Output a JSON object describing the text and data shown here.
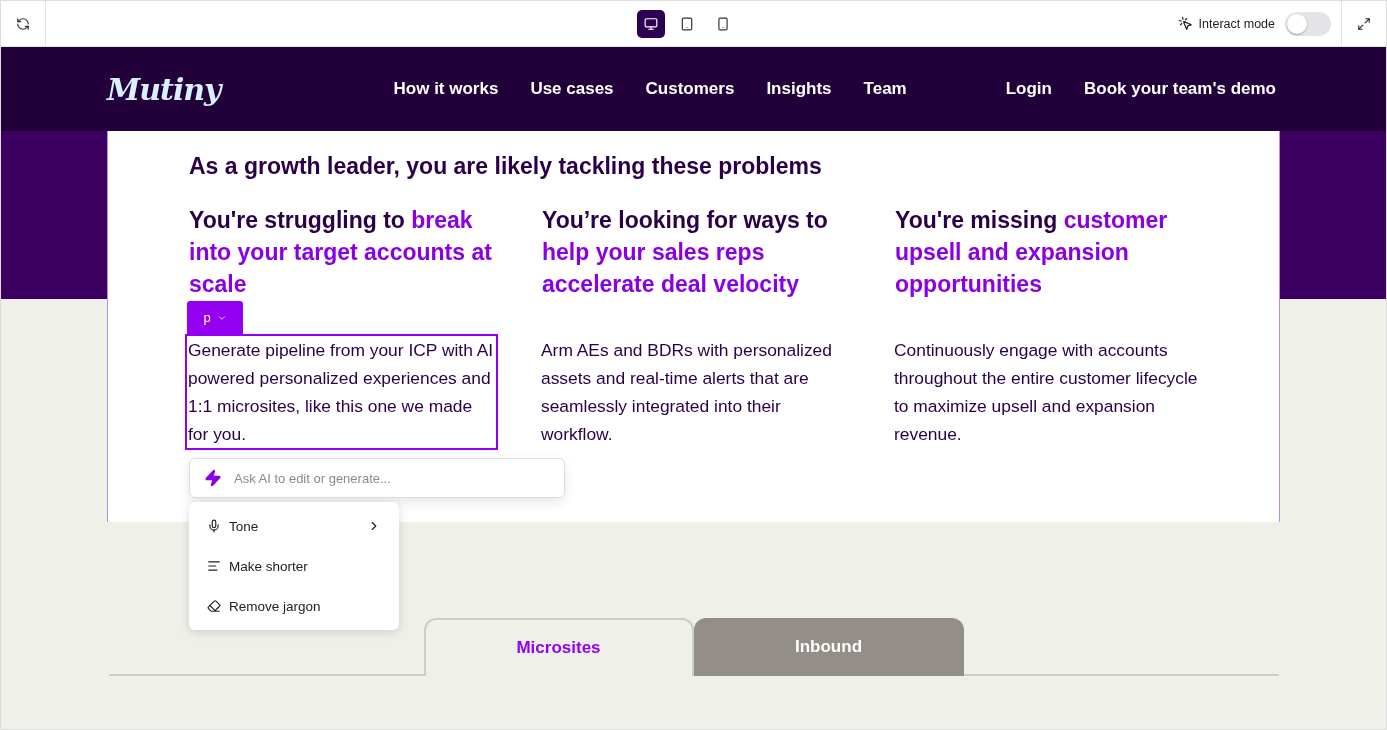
{
  "toolbar": {
    "devices": [
      {
        "kind": "desktop",
        "selected": true
      },
      {
        "kind": "tablet",
        "selected": false
      },
      {
        "kind": "phone",
        "selected": false
      }
    ],
    "interact_mode": {
      "label": "Interact mode",
      "on": false
    }
  },
  "nav": {
    "logo": "Mutiny",
    "links": [
      "How it works",
      "Use cases",
      "Customers",
      "Insights",
      "Team"
    ],
    "login": "Login",
    "cta": "Book your team's demo"
  },
  "section": {
    "title": "As a growth leader, you are likely tackling these problems",
    "columns": [
      {
        "lead": "You're struggling to ",
        "highlight": "break into your target accounts at scale",
        "body": "Generate pipeline from your ICP with AI powered personalized experiences and 1:1 microsites, like this one we made for you.",
        "selected": true
      },
      {
        "lead": "You’re looking for ways to ",
        "highlight": "help your sales reps accelerate deal velocity",
        "body": "Arm AEs and BDRs with personalized assets and real-time alerts that are seamlessly integrated into their workflow.",
        "selected": false
      },
      {
        "lead": "You're missing ",
        "highlight": "customer upsell and expansion opportunities",
        "body": "Continuously engage with accounts throughout the entire customer lifecycle to maximize upsell and expansion revenue.",
        "selected": false
      }
    ]
  },
  "editor": {
    "element_tag": "p",
    "ai_placeholder": "Ask AI to edit or generate...",
    "menu": [
      {
        "kind": "tone",
        "label": "Tone",
        "submenu": true
      },
      {
        "kind": "shorter",
        "label": "Make shorter",
        "submenu": false
      },
      {
        "kind": "jargon",
        "label": "Remove jargon",
        "submenu": false
      }
    ]
  },
  "tabs": [
    {
      "label": "Microsites",
      "selected": true
    },
    {
      "label": "Inbound",
      "selected": false
    }
  ]
}
